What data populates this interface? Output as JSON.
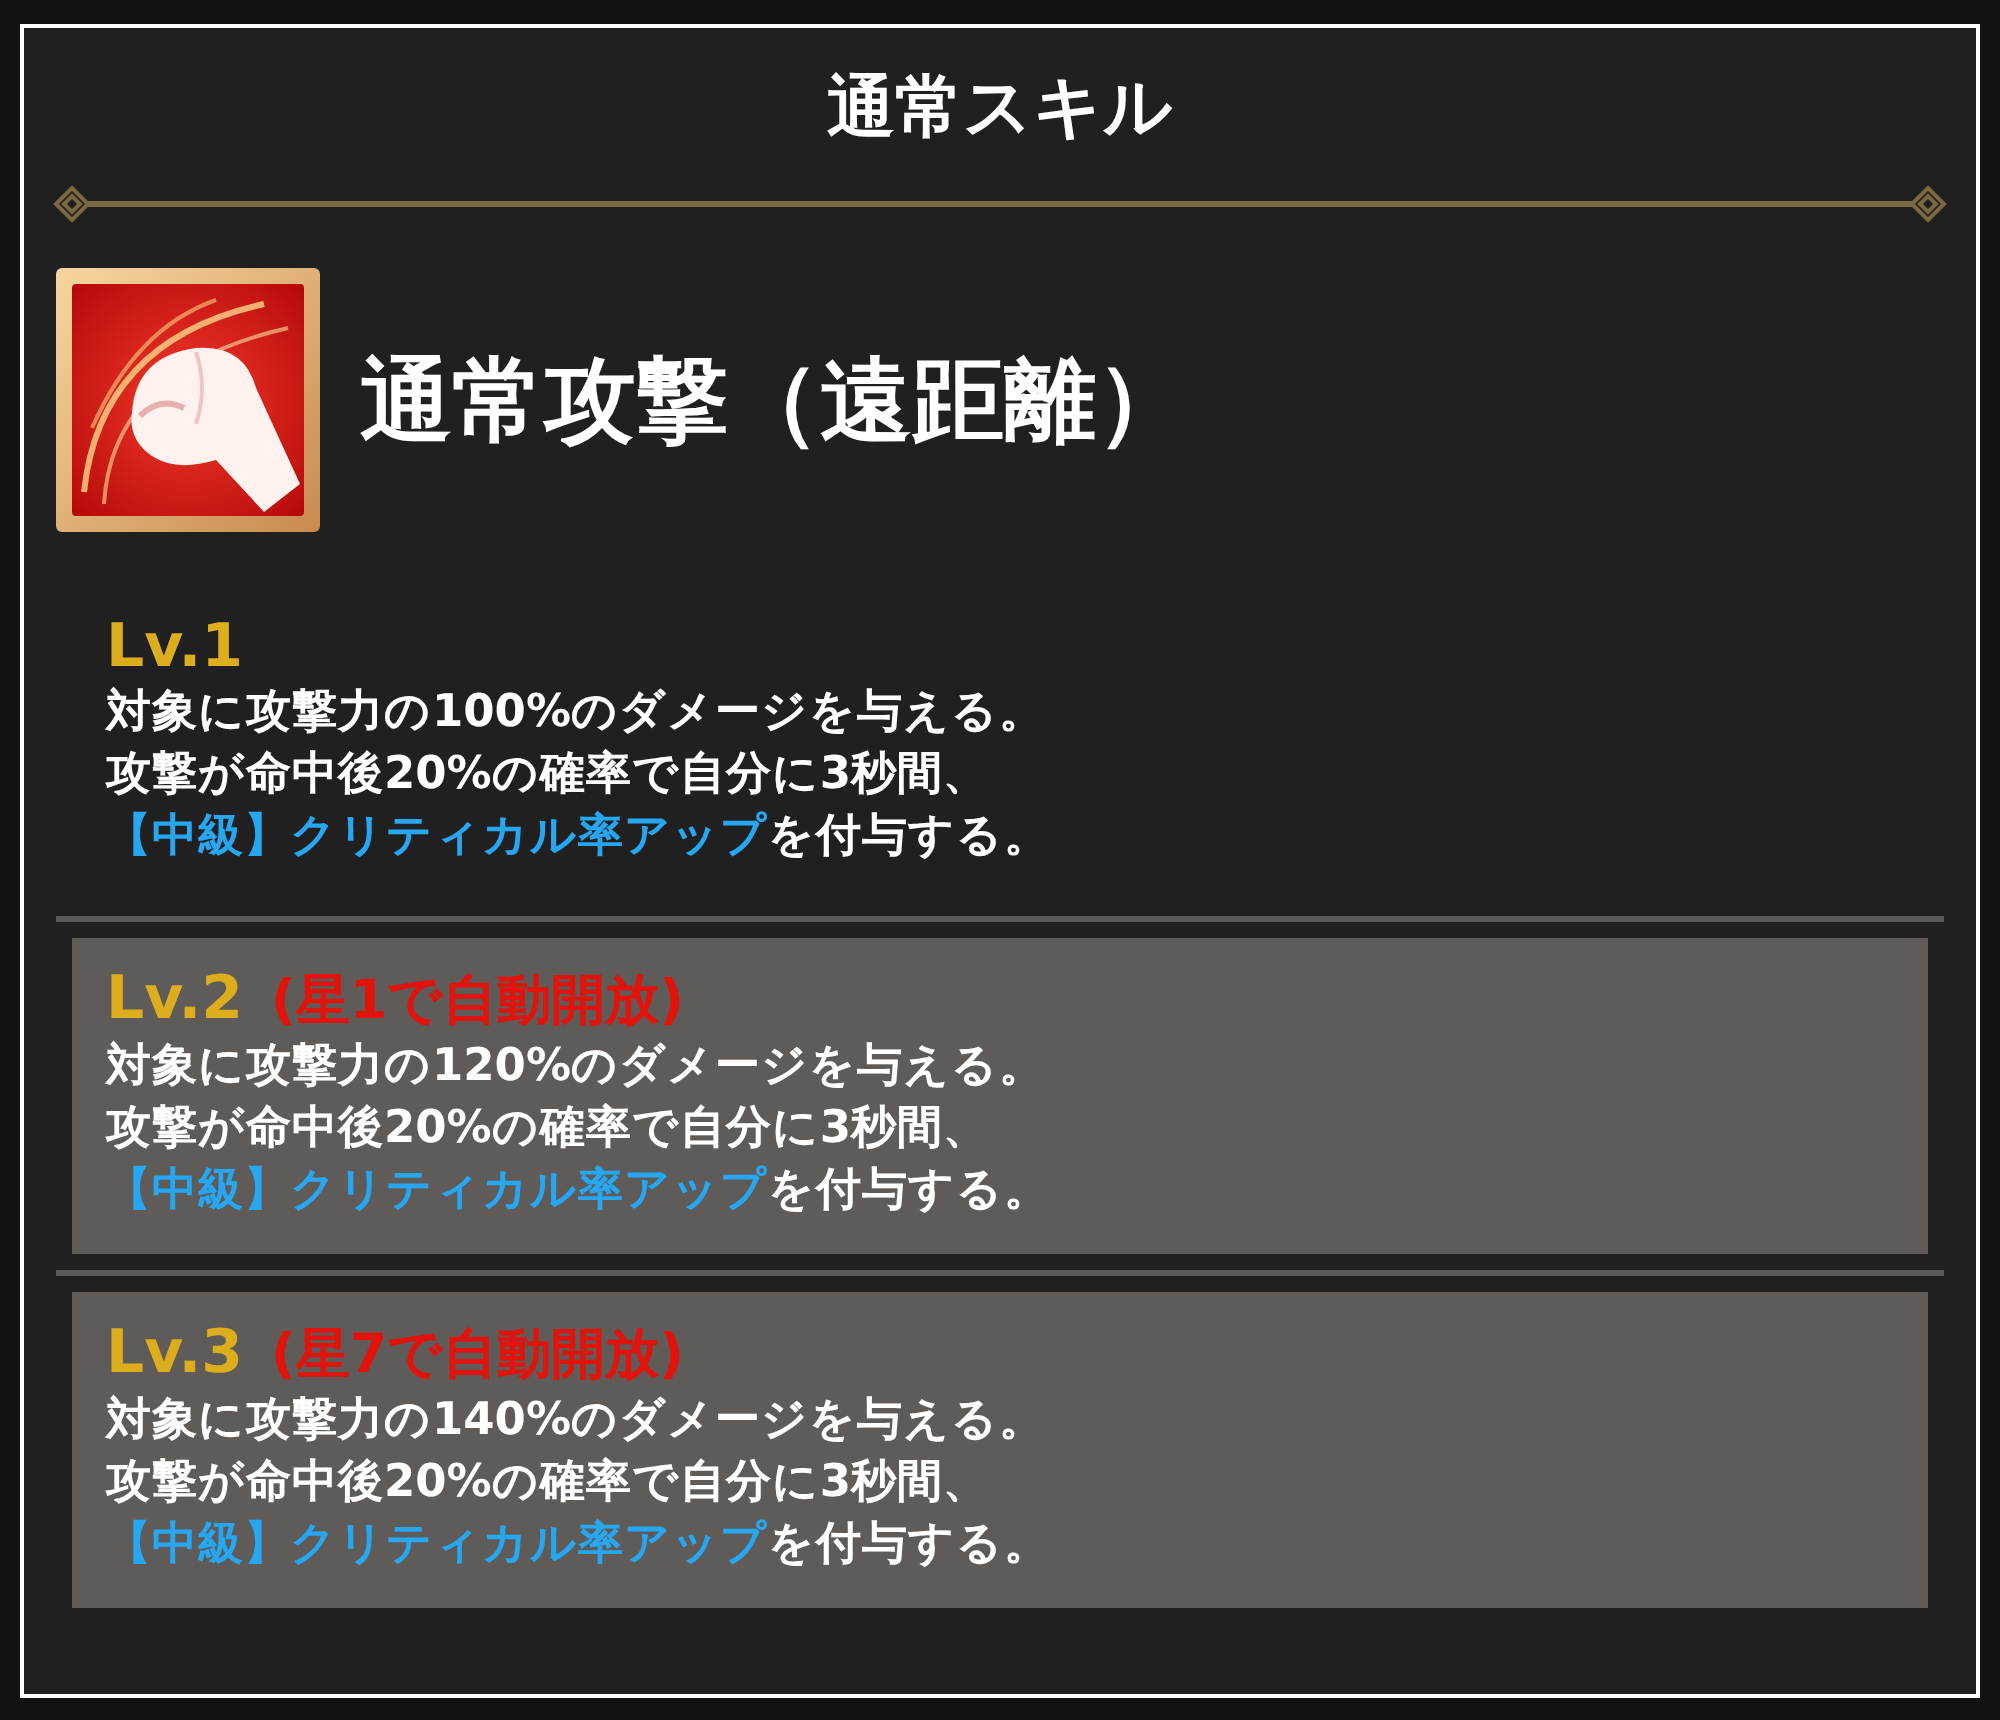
{
  "panel": {
    "title": "通常スキル"
  },
  "skill": {
    "name": "通常攻撃（遠距離）"
  },
  "levels": [
    {
      "label": "Lv.1",
      "locked": false,
      "lines": [
        [
          {
            "kind": "plain",
            "text": "対象に攻撃力の100%のダメージを与える。"
          }
        ],
        [
          {
            "kind": "plain",
            "text": "攻撃が命中後20%の確率で自分に3秒間、"
          }
        ],
        [
          {
            "kind": "buff",
            "text": "【中級】クリティカル率アップ"
          },
          {
            "kind": "plain",
            "text": "を付与する。"
          }
        ]
      ]
    },
    {
      "label": "Lv.2",
      "unlock_condition": "(星1で自動開放)",
      "locked": true,
      "lines": [
        [
          {
            "kind": "plain",
            "text": "対象に攻撃力の120%のダメージを与える。"
          }
        ],
        [
          {
            "kind": "plain",
            "text": "攻撃が命中後20%の確率で自分に3秒間、"
          }
        ],
        [
          {
            "kind": "buff",
            "text": "【中級】クリティカル率アップ"
          },
          {
            "kind": "plain",
            "text": "を付与する。"
          }
        ]
      ]
    },
    {
      "label": "Lv.3",
      "unlock_condition": "(星7で自動開放)",
      "locked": true,
      "lines": [
        [
          {
            "kind": "plain",
            "text": "対象に攻撃力の140%のダメージを与える。"
          }
        ],
        [
          {
            "kind": "plain",
            "text": "攻撃が命中後20%の確率で自分に3秒間、"
          }
        ],
        [
          {
            "kind": "buff",
            "text": "【中級】クリティカル率アップ"
          },
          {
            "kind": "plain",
            "text": "を付与する。"
          }
        ]
      ]
    }
  ]
}
